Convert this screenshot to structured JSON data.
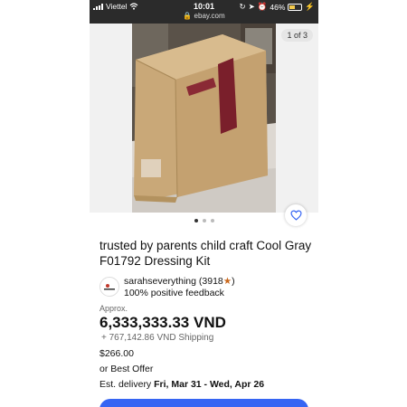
{
  "status_bar": {
    "carrier": "Viettel",
    "time": "10:01",
    "url": "ebay.com",
    "battery": "46%"
  },
  "gallery": {
    "counter": "1 of 3",
    "dots": 3,
    "active_dot": 0
  },
  "listing": {
    "title": "trusted by parents child craft Cool Gray F01792 Dressing Kit",
    "seller": {
      "name": "sarahseverything",
      "rating": "(3918",
      "rating_close": ")",
      "feedback": "100% positive feedback"
    },
    "price_note": "Approx.",
    "price": "6,333,333.33 VND",
    "shipping": "+ 767,142.86 VND Shipping",
    "original_price": "$266.00",
    "offer": "or Best Offer",
    "delivery_label": "Est. delivery ",
    "delivery_dates": "Fri, Mar 31 - Wed, Apr 26"
  },
  "colors": {
    "accent": "#3665f3",
    "status_bar_bg": "#2b2b2b",
    "star": "#c9671a"
  }
}
